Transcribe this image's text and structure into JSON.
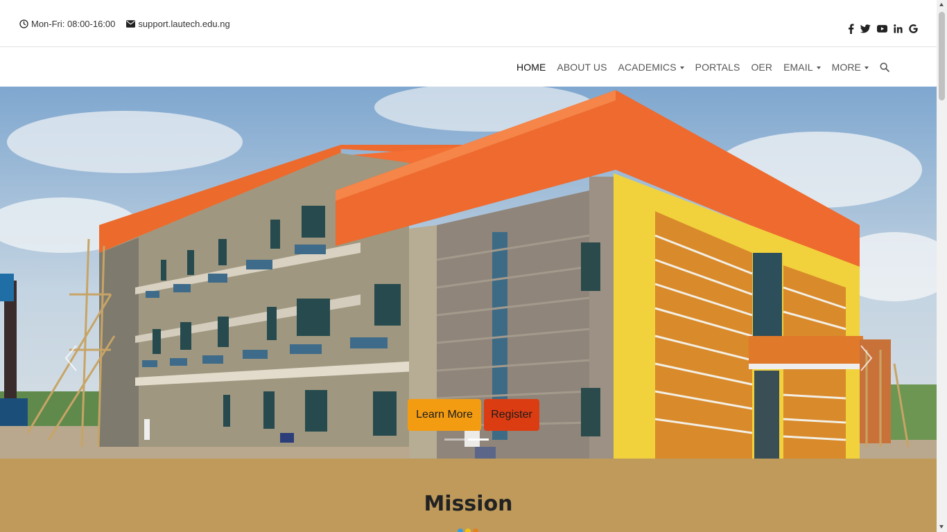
{
  "topbar": {
    "hours": "Mon-Fri: 08:00-16:00",
    "email": "support.lautech.edu.ng",
    "hours_icon": "clock-icon",
    "email_icon": "envelope-icon",
    "social": [
      "facebook-icon",
      "twitter-icon",
      "youtube-icon",
      "linkedin-icon",
      "google-icon"
    ]
  },
  "nav": {
    "items": [
      {
        "label": "HOME",
        "active": true
      },
      {
        "label": "ABOUT US"
      },
      {
        "label": "ACADEMICS",
        "dropdown": true
      },
      {
        "label": "PORTALS"
      },
      {
        "label": "OER"
      },
      {
        "label": "EMAIL",
        "dropdown": true
      },
      {
        "label": "MORE",
        "dropdown": true
      }
    ],
    "search_icon": "search-icon"
  },
  "hero": {
    "learn_more": "Learn More",
    "register": "Register",
    "slides": 2,
    "active_slide": 1
  },
  "mission": {
    "title": "Mission",
    "dot_colors": [
      "#3b9bd9",
      "#f1c40f",
      "#e67e22"
    ]
  },
  "colors": {
    "accent_orange": "#f39c12",
    "accent_red": "#dc3c12",
    "mission_bg": "#bf9a5a"
  }
}
